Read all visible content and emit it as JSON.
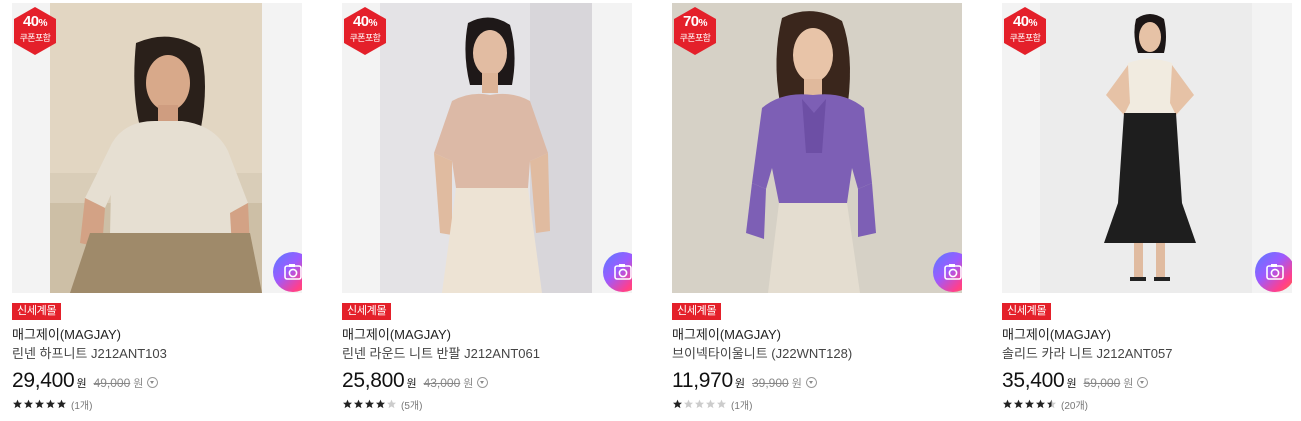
{
  "colors": {
    "badge": "#e4202a",
    "tag": "#e4202a",
    "star_on": "#222222",
    "star_off": "#cccccc"
  },
  "products": [
    {
      "discount": "40",
      "discount_unit": "%",
      "coupon": "쿠폰포함",
      "tag": "신세계몰",
      "brand": "매그제이(MAGJAY)",
      "name": "린넨 하프니트 J212ANT103",
      "price": "29,400",
      "won": "원",
      "original_price": "49,000",
      "won_orig": "원",
      "rating": 5,
      "review_count": "(1개)",
      "photo": "model-beige-knit",
      "icon": "camera-icon"
    },
    {
      "discount": "40",
      "discount_unit": "%",
      "coupon": "쿠폰포함",
      "tag": "신세계몰",
      "brand": "매그제이(MAGJAY)",
      "name": "린넨 라운드 니트 반팔 J212ANT061",
      "price": "25,800",
      "won": "원",
      "original_price": "43,000",
      "won_orig": "원",
      "rating": 4,
      "review_count": "(5개)",
      "photo": "model-pink-knit",
      "icon": "camera-icon"
    },
    {
      "discount": "70",
      "discount_unit": "%",
      "coupon": "쿠폰포함",
      "tag": "신세계몰",
      "brand": "매그제이(MAGJAY)",
      "name": "브이넥타이울니트 (J22WNT128)",
      "price": "11,970",
      "won": "원",
      "original_price": "39,900",
      "won_orig": "원",
      "rating": 1,
      "review_count": "(1개)",
      "photo": "model-purple-knit",
      "icon": "camera-icon"
    },
    {
      "discount": "40",
      "discount_unit": "%",
      "coupon": "쿠폰포함",
      "tag": "신세계몰",
      "brand": "매그제이(MAGJAY)",
      "name": "솔리드 카라 니트 J212ANT057",
      "price": "35,400",
      "won": "원",
      "original_price": "59,000",
      "won_orig": "원",
      "rating": 4.5,
      "review_count": "(20개)",
      "photo": "model-ivory-knit",
      "icon": "camera-icon"
    }
  ]
}
